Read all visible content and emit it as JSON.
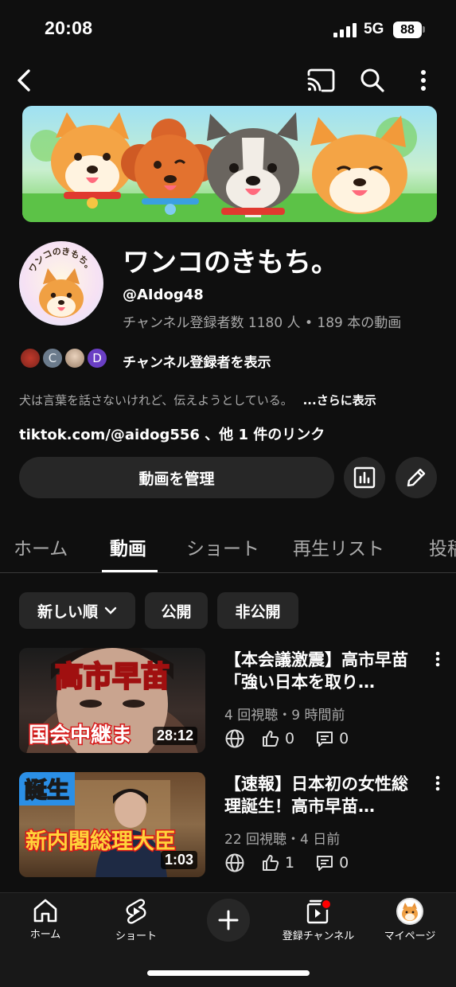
{
  "status_bar": {
    "time": "20:08",
    "network": "5G",
    "battery": "88"
  },
  "banner": {
    "label": "ワンコのきもち。"
  },
  "channel": {
    "title": "ワンコのきもち。",
    "handle": "@AIdog48",
    "stats": "チャンネル登録者数 1180 人 • 189 本の動画",
    "subscriber_initials": [
      "C",
      "D"
    ],
    "show_subscribers": "チャンネル登録者を表示",
    "description": "犬は言葉を話さないけれど、伝えようとしている。",
    "more": "...さらに表示",
    "links": "tiktok.com/@aidog556 、他 1 件のリンク",
    "manage_button": "動画を管理"
  },
  "tabs": [
    {
      "label": "ホーム"
    },
    {
      "label": "動画"
    },
    {
      "label": "ショート"
    },
    {
      "label": "再生リスト"
    },
    {
      "label": "投稿"
    }
  ],
  "chips": [
    {
      "label": "新しい順"
    },
    {
      "label": "公開"
    },
    {
      "label": "非公開"
    }
  ],
  "videos": [
    {
      "title": "【本会議激震】高市早苗「強い日本を取り…",
      "meta": "4 回視聴・9 時間前",
      "likes": "0",
      "comments": "0",
      "duration": "28:12",
      "thumb_text_top": "高市早苗",
      "thumb_text_bottom": "国会中継ま"
    },
    {
      "title": "【速報】日本初の女性総理誕生！高市早苗…",
      "meta": "22 回視聴・4 日前",
      "likes": "1",
      "comments": "0",
      "duration": "1:03",
      "thumb_text_top": "誕生",
      "thumb_text_bottom": "新内閣総理大臣"
    }
  ],
  "bottom_nav": [
    {
      "label": "ホーム"
    },
    {
      "label": "ショート"
    },
    {
      "label": "登録チャンネル"
    },
    {
      "label": "マイページ"
    }
  ],
  "colors": {
    "background": "#0f0f0f",
    "surface": "#272727",
    "accent_red": "#ff0000",
    "muted_text": "#aaaaaa"
  }
}
